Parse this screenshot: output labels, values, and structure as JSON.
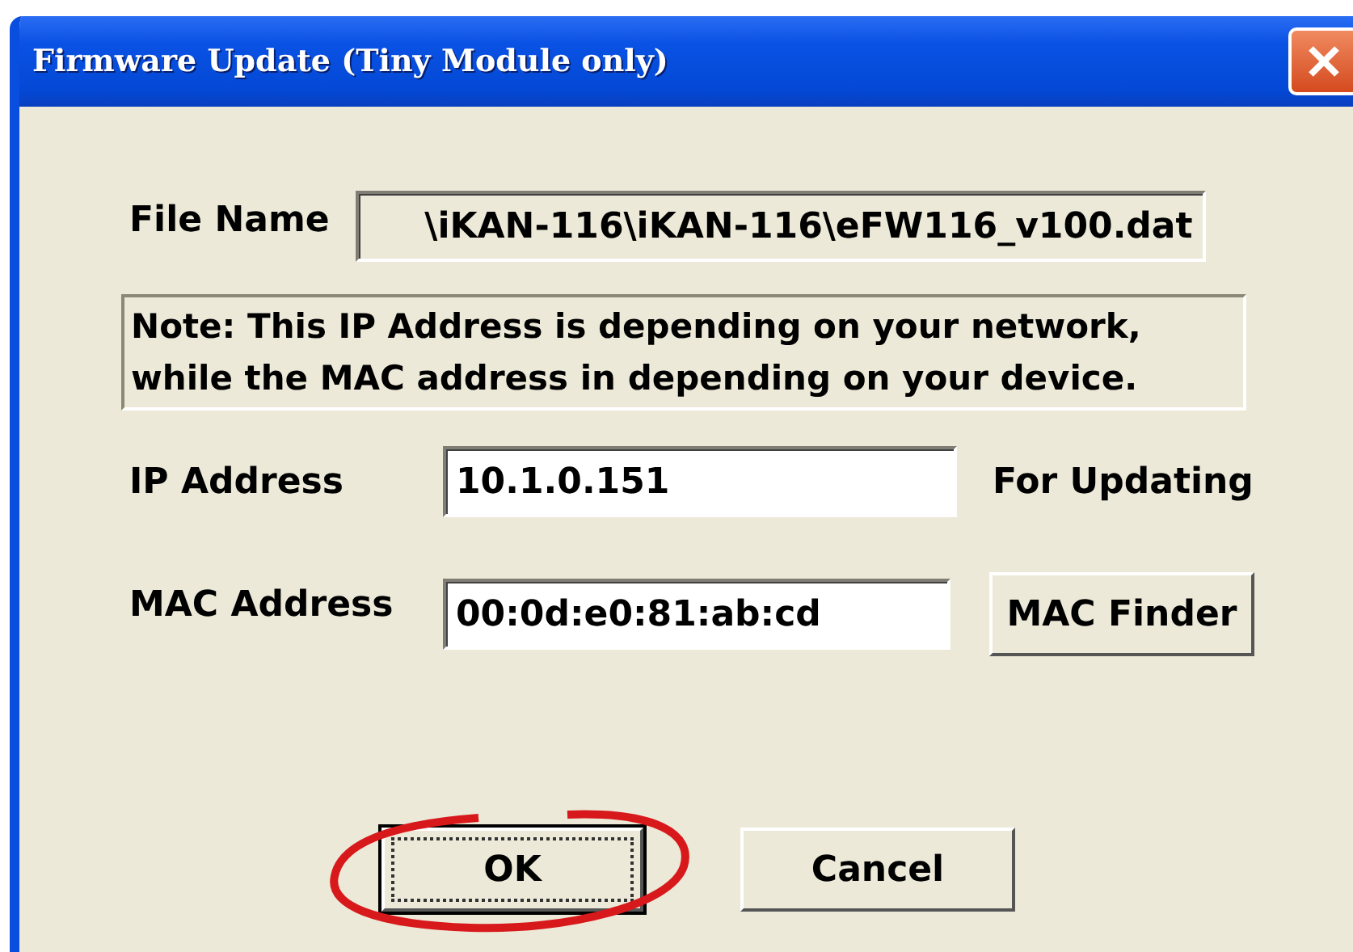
{
  "window": {
    "title": "Firmware Update (Tiny Module only)"
  },
  "file_name": {
    "label": "File Name",
    "value": "\\iKAN-116\\iKAN-116\\eFW116_v100.dat"
  },
  "note": {
    "lines": [
      "Note: This IP Address is depending on your network,",
      "while the  MAC address in depending on your device."
    ]
  },
  "ip_address": {
    "label": "IP Address",
    "value": "10.1.0.151",
    "suffix": "For Updating"
  },
  "mac_address": {
    "label": "MAC Address",
    "value": "00:0d:e0:81:ab:cd",
    "button": "MAC Finder"
  },
  "buttons": [
    {
      "label": "OK",
      "default": true,
      "highlighted": true
    },
    {
      "label": "Cancel",
      "default": false,
      "highlighted": false
    }
  ]
}
